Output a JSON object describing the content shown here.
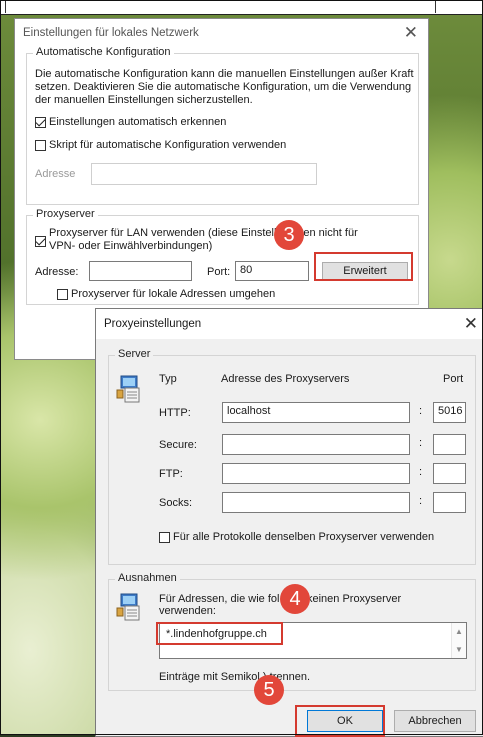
{
  "lan_dialog": {
    "title": "Einstellungen für lokales Netzwerk",
    "auto_group": {
      "legend": "Automatische Konfiguration",
      "desc_lines": [
        "Die automatische Konfiguration kann die manuellen Einstellungen außer Kraft",
        "setzen. Deaktivieren Sie die automatische Konfiguration, um die Verwendung",
        "der manuellen Einstellungen sicherzustellen."
      ],
      "detect_label": "Einstellungen automatisch erkennen",
      "detect_checked": true,
      "script_label": "Skript für automatische Konfiguration verwenden",
      "script_checked": false,
      "address_label": "Adresse",
      "address_value": ""
    },
    "proxy_group": {
      "legend": "Proxyserver",
      "use_proxy_line1": "Proxyserver für LAN verwenden (diese Einstellu       gelten nicht für",
      "use_proxy_line2": "VPN- oder Einwählverbindungen)",
      "use_proxy_checked": true,
      "address_label": "Adresse:",
      "address_value": "",
      "port_label": "Port:",
      "port_value": "80",
      "advanced_button": "Erweitert",
      "bypass_label": "Proxyserver für lokale Adressen umgehen",
      "bypass_checked": false
    }
  },
  "proxy_dialog": {
    "title": "Proxyeinstellungen",
    "server_group": {
      "legend": "Server",
      "col_type": "Typ",
      "col_address": "Adresse des Proxyservers",
      "col_port": "Port",
      "rows": [
        {
          "label": "HTTP:",
          "address": "localhost",
          "port": "5016"
        },
        {
          "label": "Secure:",
          "address": "",
          "port": ""
        },
        {
          "label": "FTP:",
          "address": "",
          "port": ""
        },
        {
          "label": "Socks:",
          "address": "",
          "port": ""
        }
      ],
      "colon": ":",
      "same_proxy_label": "Für alle Protokolle denselben Proxyserver verwenden",
      "same_proxy_checked": false
    },
    "exceptions_group": {
      "legend": "Ausnahmen",
      "desc_line1": "Für Adressen, die wie fol          nen, keinen Proxyserver",
      "desc_line2": "verwenden:",
      "exceptions_value": "*.lindenhofgruppe.ch",
      "hint": "Einträge mit Semikol        ) trennen."
    },
    "ok_button": "OK",
    "cancel_button": "Abbrechen"
  },
  "annotations": {
    "step3": "3",
    "step4": "4",
    "step5": "5",
    "color": "#d43a2f"
  },
  "close_glyph": "✕"
}
